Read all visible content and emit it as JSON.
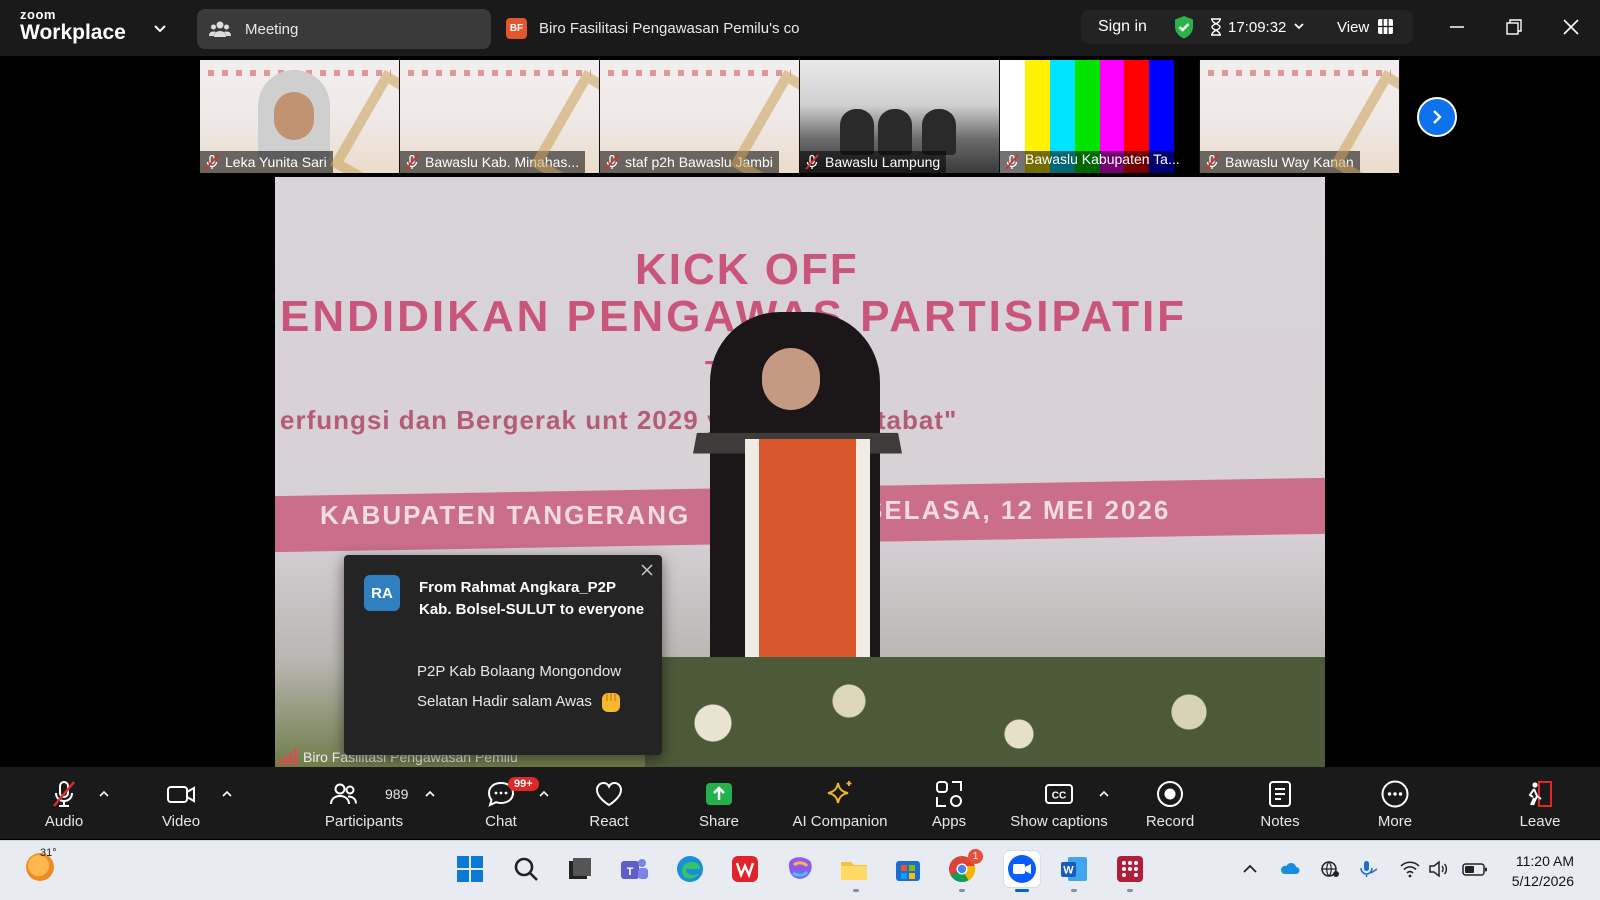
{
  "app": {
    "logo_line1": "zoom",
    "logo_line2": "Workplace"
  },
  "tabs": {
    "meeting_label": "Meeting",
    "meeting_badge": "BF",
    "meeting_title": "Biro Fasilitasi Pengawasan Pemilu's co"
  },
  "status": {
    "sign_in": "Sign in",
    "timer": "17:09:32",
    "view_label": "View"
  },
  "gallery": [
    {
      "name": "Leka Yunita Sari",
      "kind": "face"
    },
    {
      "name": "Bawaslu Kab. Minahas...",
      "kind": "banner"
    },
    {
      "name": "staf p2h Bawaslu Jambi",
      "kind": "banner"
    },
    {
      "name": "Bawaslu Lampung",
      "kind": "room"
    },
    {
      "name": "Bawaslu Kabupaten Ta...",
      "kind": "bars"
    },
    {
      "name": "Bawaslu Way Kanan",
      "kind": "banner"
    }
  ],
  "colorbars": [
    "#ffffff",
    "#fff200",
    "#00e5ff",
    "#00e400",
    "#ff00ff",
    "#ff0000",
    "#0000ff",
    "#000000"
  ],
  "main_video": {
    "banner_line1": "KICK OFF",
    "banner_line2": "ENDIDIKAN PENGAWAS PARTISIPATIF",
    "banner_line3": "Te",
    "banner_line4": "erfungsi dan Bergerak unt              2029 yang Bermartabat\"",
    "banner_line5": "KABUPATEN TANGERANG",
    "banner_line6": "SELASA, 12 MEI 2026",
    "speaker_label": "Biro Fasilitasi Pengawasan Pemilu"
  },
  "chat_toast": {
    "avatar": "RA",
    "from": "From Rahmat Angkara_P2P Kab. Bolsel-SULUT to everyone",
    "message": "P2P Kab Bolaang Mongondow Selatan Hadir salam Awas"
  },
  "toolbar": {
    "audio": "Audio",
    "video": "Video",
    "participants": "Participants",
    "participants_count": "989",
    "chat": "Chat",
    "chat_badge": "99+",
    "react": "React",
    "share": "Share",
    "ai_companion": "AI Companion",
    "apps": "Apps",
    "show_captions": "Show captions",
    "record": "Record",
    "notes": "Notes",
    "more": "More",
    "leave": "Leave"
  },
  "taskbar": {
    "temperature": "31°",
    "chrome_badge": "1",
    "time": "11:20 AM",
    "date": "5/12/2026"
  },
  "colors": {
    "accent": "#0e72ed",
    "leave": "#e02828",
    "share": "#24b14b"
  }
}
